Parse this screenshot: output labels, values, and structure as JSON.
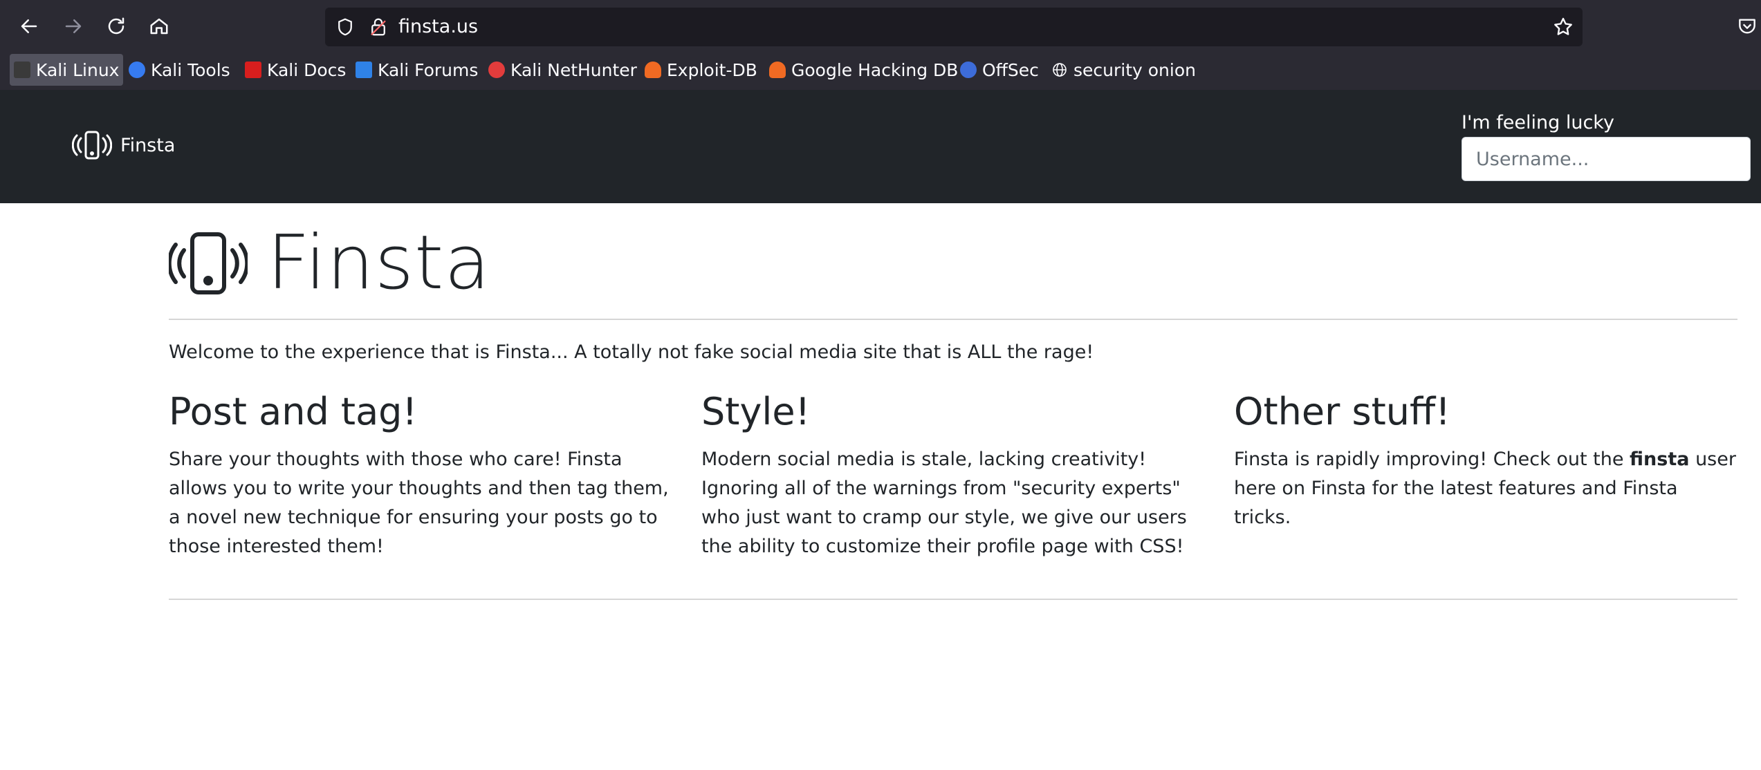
{
  "browser": {
    "url": "finsta.us",
    "bookmarks": [
      {
        "label": "Kali Linux",
        "icon": "kali-dragon-icon",
        "color": "#3a3a3a"
      },
      {
        "label": "Kali Tools",
        "icon": "kali-tools-icon",
        "color": "#367bf0"
      },
      {
        "label": "Kali Docs",
        "icon": "kali-docs-icon",
        "color": "#d81e1e"
      },
      {
        "label": "Kali Forums",
        "icon": "kali-forums-icon",
        "color": "#2f82e8"
      },
      {
        "label": "Kali NetHunter",
        "icon": "kali-nethunter-icon",
        "color": "#e23c3c"
      },
      {
        "label": "Exploit-DB",
        "icon": "exploit-db-icon",
        "color": "#f06a23"
      },
      {
        "label": "Google Hacking DB",
        "icon": "ghdb-icon",
        "color": "#f06a23"
      },
      {
        "label": "OffSec",
        "icon": "offsec-icon",
        "color": "#3d6cd9"
      },
      {
        "label": "security onion",
        "icon": "globe-icon",
        "color": "#fbfbfe"
      }
    ]
  },
  "navbar": {
    "brand": "Finsta",
    "lucky_label": "I'm feeling lucky",
    "username_placeholder": "Username..."
  },
  "hero": {
    "title": "Finsta",
    "lead": "Welcome to the experience that is Finsta... A totally not fake social media site that is ALL the rage!"
  },
  "columns": [
    {
      "heading": "Post and tag!",
      "text": "Share your thoughts with those who care! Finsta allows you to write your thoughts and then tag them, a novel new technique for ensuring your posts go to those interested them!"
    },
    {
      "heading": "Style!",
      "text": "Modern social media is stale, lacking creativity! Ignoring all of the warnings from \"security experts\" who just want to cramp our style, we give our users the ability to customize their profile page with CSS!"
    },
    {
      "heading": "Other stuff!",
      "text_before": "Finsta is rapidly improving! Check out the ",
      "text_bold": "finsta",
      "text_after": " user here on Finsta for the latest features and Finsta tricks."
    }
  ],
  "colors": {
    "browser_chrome": "#2b2a33",
    "navbar": "#212529",
    "text": "#212529"
  }
}
